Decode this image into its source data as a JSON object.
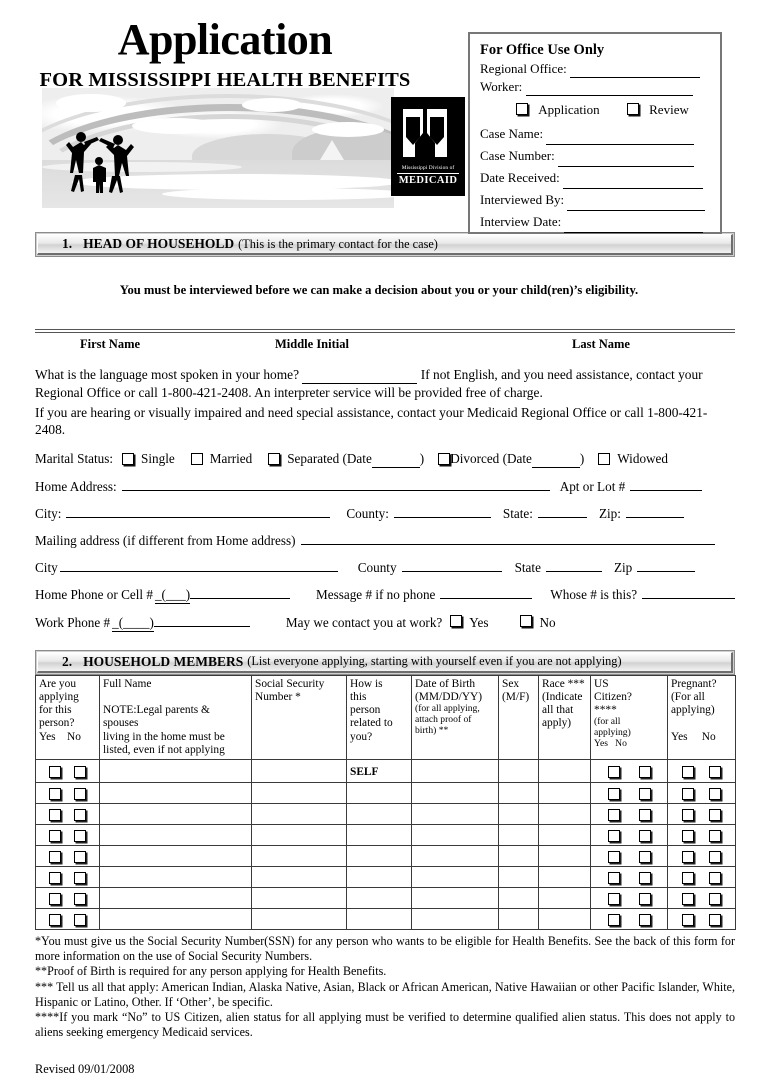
{
  "header": {
    "title": "Application",
    "subtitle": "FOR MISSISSIPPI HEALTH BENEFITS",
    "logo": {
      "line1": "Mississippi Division of",
      "line2": "MEDICAID"
    }
  },
  "office_box": {
    "title": "For Office Use Only",
    "regional_office_label": "Regional Office:",
    "worker_label": "Worker:",
    "application_checkbox_label": "Application",
    "review_checkbox_label": "Review",
    "case_name_label": "Case Name:",
    "case_number_label": "Case Number:",
    "date_received_label": "Date Received:",
    "interviewed_by_label": "Interviewed By:",
    "interview_date_label": "Interview Date:"
  },
  "section1": {
    "number": "1.",
    "title": "HEAD OF HOUSEHOLD",
    "note": "(This is the primary contact for the case)",
    "interview_notice": "You must be interviewed before we can make a decision about you or your child(ren)’s eligibility.",
    "name_labels": {
      "first": "First Name",
      "middle": "Middle Initial",
      "last": "Last Name"
    },
    "language_q_part1": "What is the language most spoken in your home?",
    "language_q_part2": "If not English, and you need assistance, contact your Regional Office or call 1-800-421-2408.  An interpreter service will be provided free of charge.",
    "impaired_text": "If you are hearing or visually impaired and need special assistance, contact your Medicaid Regional Office or call 1-800-421-2408.",
    "marital": {
      "label": "Marital Status:",
      "single": "Single",
      "married": "Married",
      "separated": "Separated (Date",
      "separated_close": ")",
      "divorced": "Divorced (Date",
      "divorced_close": ")",
      "widowed": "Widowed"
    },
    "fields": {
      "home_address": "Home Address:",
      "apt_or_lot": "Apt or Lot #",
      "city": "City:",
      "county": "County:",
      "state": "State:",
      "zip": "Zip:",
      "mailing_address": "Mailing address (if different from Home address)",
      "city2": "City",
      "county2": "County",
      "state2": "State",
      "zip2": "Zip",
      "home_phone": "Home Phone or Cell #",
      "phone_area": "_(___)",
      "message_number": "Message # if no phone",
      "whose_number": "Whose # is this?",
      "work_phone": "Work Phone #",
      "work_phone_area": "_(____)",
      "contact_at_work": "May we contact you at work?",
      "yes": "Yes",
      "no": "No"
    }
  },
  "section2": {
    "number": "2.",
    "title": "HOUSEHOLD MEMBERS",
    "note": "(List everyone applying, starting with yourself even if you are not applying)",
    "columns": [
      {
        "key": "applying",
        "lines": [
          "Are you",
          "applying",
          "for this",
          "person?",
          "Yes    No"
        ]
      },
      {
        "key": "full_name",
        "lines": [
          "Full Name",
          "",
          "NOTE:Legal parents & spouses",
          "living in the home must be",
          "listed, even if not applying"
        ]
      },
      {
        "key": "ssn",
        "lines": [
          "Social Security",
          "Number *"
        ]
      },
      {
        "key": "relation",
        "lines": [
          "How is",
          "this",
          "person",
          "related to",
          "you?"
        ]
      },
      {
        "key": "dob",
        "lines": [
          "Date of Birth",
          "(MM/DD/YY)"
        ],
        "small": [
          "(for all applying,",
          "attach proof of",
          "birth) **"
        ]
      },
      {
        "key": "sex",
        "lines": [
          "Sex",
          "(M/F)"
        ]
      },
      {
        "key": "race",
        "lines": [
          "Race ***",
          "(Indicate",
          "all that",
          "apply)"
        ]
      },
      {
        "key": "citizen",
        "lines": [
          "US",
          "Citizen?",
          "****"
        ],
        "small": [
          "(for all",
          "applying)",
          "Yes   No"
        ]
      },
      {
        "key": "pregnant",
        "lines": [
          "Pregnant?",
          "(For all",
          "applying)",
          "",
          "Yes     No"
        ]
      }
    ],
    "rows": [
      {
        "relation": "SELF"
      },
      {
        "relation": ""
      },
      {
        "relation": ""
      },
      {
        "relation": ""
      },
      {
        "relation": ""
      },
      {
        "relation": ""
      },
      {
        "relation": ""
      },
      {
        "relation": ""
      }
    ]
  },
  "footnotes": {
    "f1": "*You must give us the Social Security Number(SSN) for any person who wants to be eligible for Health Benefits.  See the back of this form for more information on the use of Social Security Numbers.",
    "f2": "**Proof of Birth is required for any person applying for Health Benefits.",
    "f3": "*** Tell us all that apply: American Indian, Alaska Native, Asian, Black or African American, Native Hawaiian or other Pacific Islander, White, Hispanic or Latino, Other.   If ‘Other’, be specific.",
    "f4": "****If you mark “No” to US Citizen, alien status for all applying must be verified to determine qualified alien status.  This does not apply to aliens seeking emergency Medicaid services."
  },
  "revised": "Revised 09/01/2008"
}
